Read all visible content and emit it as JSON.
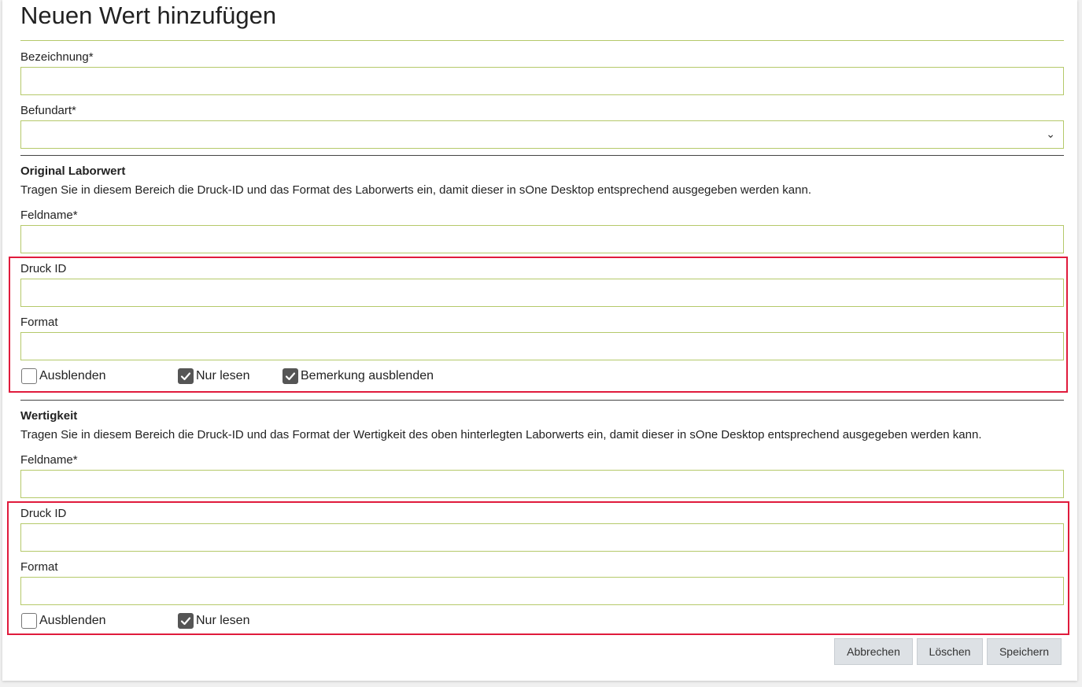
{
  "form": {
    "title": "Neuen Wert hinzufügen",
    "bezeichnung_label": "Bezeichnung*",
    "bezeichnung_value": "",
    "befundart_label": "Befundart*",
    "befundart_value": ""
  },
  "original": {
    "heading": "Original Laborwert",
    "description": "Tragen Sie in diesem Bereich die Druck-ID und das Format des Laborwerts ein, damit dieser in sOne Desktop entsprechend ausgegeben werden kann.",
    "feldname_label": "Feldname*",
    "druck_id_label": "Druck ID",
    "format_label": "Format",
    "checkboxes": [
      {
        "label": "Ausblenden",
        "checked": false
      },
      {
        "label": "Nur lesen",
        "checked": true
      },
      {
        "label": "Bemerkung ausblenden",
        "checked": true
      }
    ]
  },
  "wertigkeit": {
    "heading": "Wertigkeit",
    "description": "Tragen Sie in diesem Bereich die Druck-ID und das Format der Wertigkeit des oben hinterlegten Laborwerts ein, damit dieser in sOne Desktop entsprechend ausgegeben werden kann.",
    "feldname_label": "Feldname*",
    "druck_id_label": "Druck ID",
    "format_label": "Format",
    "checkboxes": [
      {
        "label": "Ausblenden",
        "checked": false
      },
      {
        "label": "Nur lesen",
        "checked": true
      }
    ]
  },
  "buttons": {
    "cancel": "Abbrechen",
    "delete": "Löschen",
    "save": "Speichern"
  },
  "colors": {
    "accent_border": "#b5c96a",
    "highlight_red": "#e01b3c",
    "button_bg": "#dde1e5"
  }
}
